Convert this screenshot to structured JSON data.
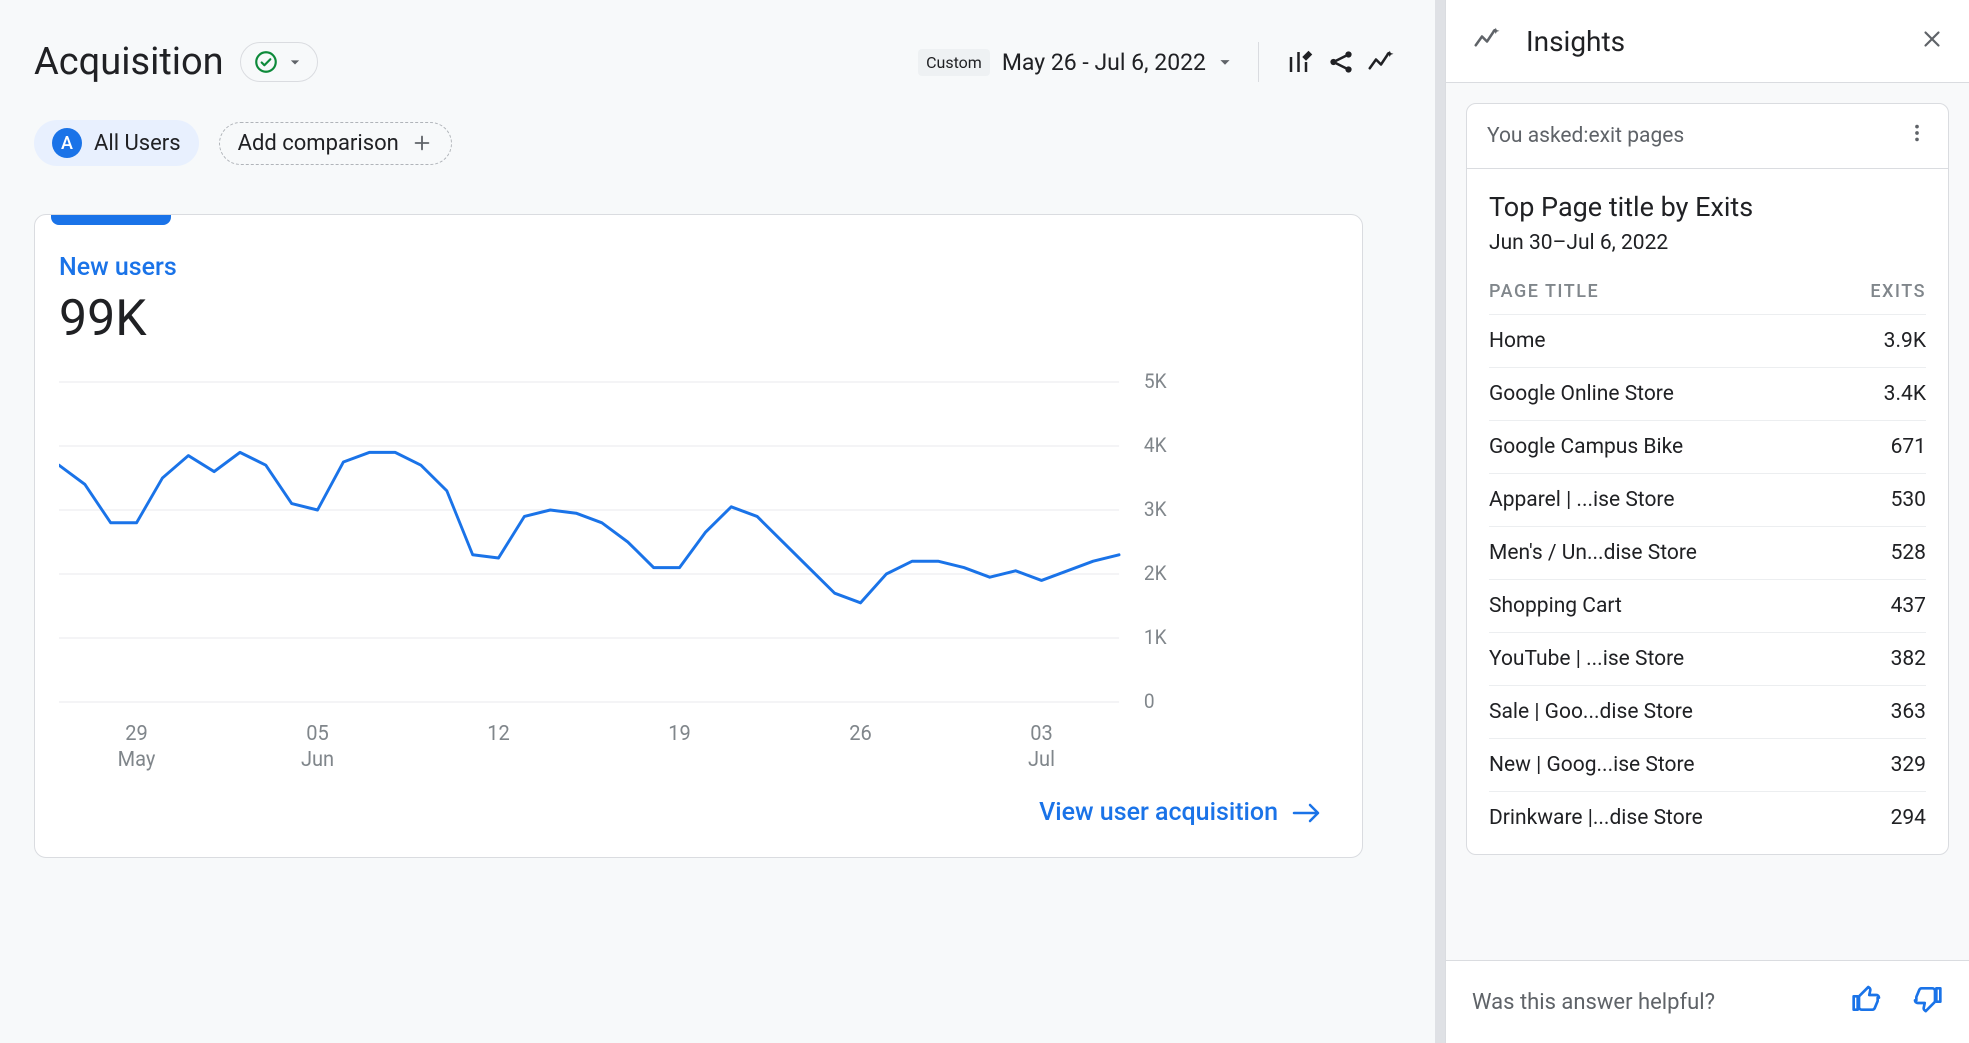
{
  "header": {
    "title": "Acquisition",
    "date_label": "Custom",
    "date_range": "May 26 - Jul 6, 2022"
  },
  "segments": {
    "primary_badge": "A",
    "primary_label": "All Users",
    "add_label": "Add comparison"
  },
  "card": {
    "metric_label": "New users",
    "metric_value": "99K",
    "footer_link": "View user acquisition"
  },
  "insights": {
    "panel_title": "Insights",
    "asked_prefix": "You asked: ",
    "asked_query": "exit pages",
    "card_title": "Top Page title by Exits",
    "card_subtitle": "Jun 30–Jul 6, 2022",
    "col_page": "PAGE TITLE",
    "col_exits": "EXITS",
    "rows": [
      {
        "title": "Home",
        "exits": "3.9K"
      },
      {
        "title": "Google Online Store",
        "exits": "3.4K"
      },
      {
        "title": "Google Campus Bike",
        "exits": "671"
      },
      {
        "title": "Apparel | ...ise Store",
        "exits": "530"
      },
      {
        "title": "Men's / Un...dise Store",
        "exits": "528"
      },
      {
        "title": "Shopping Cart",
        "exits": "437"
      },
      {
        "title": "YouTube | ...ise Store",
        "exits": "382"
      },
      {
        "title": "Sale | Goo...dise Store",
        "exits": "363"
      },
      {
        "title": "New | Goog...ise Store",
        "exits": "329"
      },
      {
        "title": "Drinkware |...dise Store",
        "exits": "294"
      }
    ],
    "footer_question": "Was this answer helpful?"
  },
  "chart_data": {
    "type": "line",
    "title": "New users",
    "xlabel": "",
    "ylabel": "",
    "ylim": [
      0,
      5000
    ],
    "y_ticks": [
      "5K",
      "4K",
      "3K",
      "2K",
      "1K",
      "0"
    ],
    "x_ticks": [
      {
        "top": "29",
        "bottom": "May"
      },
      {
        "top": "05",
        "bottom": "Jun"
      },
      {
        "top": "12",
        "bottom": ""
      },
      {
        "top": "19",
        "bottom": ""
      },
      {
        "top": "26",
        "bottom": ""
      },
      {
        "top": "03",
        "bottom": "Jul"
      }
    ],
    "x": [
      "2022-05-26",
      "2022-05-27",
      "2022-05-28",
      "2022-05-29",
      "2022-05-30",
      "2022-05-31",
      "2022-06-01",
      "2022-06-02",
      "2022-06-03",
      "2022-06-04",
      "2022-06-05",
      "2022-06-06",
      "2022-06-07",
      "2022-06-08",
      "2022-06-09",
      "2022-06-10",
      "2022-06-11",
      "2022-06-12",
      "2022-06-13",
      "2022-06-14",
      "2022-06-15",
      "2022-06-16",
      "2022-06-17",
      "2022-06-18",
      "2022-06-19",
      "2022-06-20",
      "2022-06-21",
      "2022-06-22",
      "2022-06-23",
      "2022-06-24",
      "2022-06-25",
      "2022-06-26",
      "2022-06-27",
      "2022-06-28",
      "2022-06-29",
      "2022-06-30",
      "2022-07-01",
      "2022-07-02",
      "2022-07-03",
      "2022-07-04",
      "2022-07-05",
      "2022-07-06"
    ],
    "values": [
      3700,
      3400,
      2800,
      2800,
      3500,
      3850,
      3600,
      3900,
      3700,
      3100,
      3000,
      3750,
      3900,
      3900,
      3700,
      3300,
      2300,
      2250,
      2900,
      3000,
      2950,
      2800,
      2500,
      2100,
      2100,
      2650,
      3050,
      2900,
      2500,
      2100,
      1700,
      1550,
      2000,
      2200,
      2200,
      2100,
      1950,
      2050,
      1900,
      2050,
      2200,
      2300
    ]
  }
}
